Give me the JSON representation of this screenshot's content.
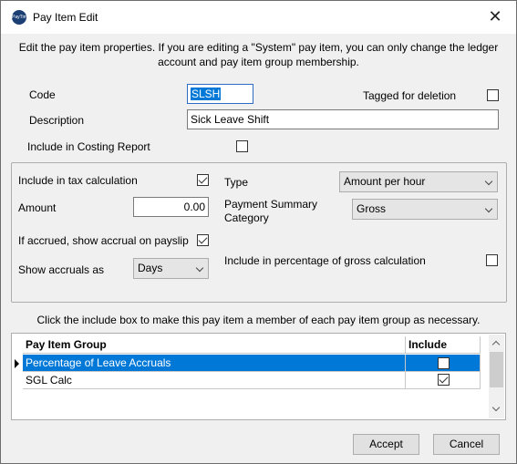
{
  "window": {
    "app_icon_text": "PayTime",
    "title": "Pay Item Edit",
    "close_glyph": "✕"
  },
  "intro_text": "Edit the pay item properties.  If you are editing a \"System\" pay item, you can only change the ledger account and pay item group membership.",
  "code": {
    "label": "Code",
    "value": "SLSH"
  },
  "tagged_for_deletion": {
    "label": "Tagged for deletion",
    "checked": false
  },
  "description": {
    "label": "Description",
    "value": "Sick Leave Shift"
  },
  "include_costing": {
    "label": "Include in Costing Report",
    "checked": false
  },
  "properties": {
    "include_tax": {
      "label": "Include in tax calculation",
      "checked": true
    },
    "amount": {
      "label": "Amount",
      "value": "0.00"
    },
    "show_accrual": {
      "label": "If accrued, show accrual on payslip",
      "checked": true
    },
    "show_accruals_as": {
      "label": "Show accruals as",
      "value": "Days"
    },
    "type": {
      "label": "Type",
      "value": "Amount per hour"
    },
    "payment_summary": {
      "label_line1": "Payment Summary",
      "label_line2": "Category",
      "value": "Gross"
    },
    "include_pct_gross": {
      "label": "Include in percentage of gross calculation",
      "checked": false
    }
  },
  "group_instructions": "Click the include box to make this pay item a member of each pay item group as necessary.",
  "group_grid": {
    "columns": [
      "Pay Item Group",
      "Include"
    ],
    "rows": [
      {
        "name": "Percentage of Leave Accruals",
        "include": false,
        "selected": true
      },
      {
        "name": "SGL Calc",
        "include": true,
        "selected": false
      }
    ]
  },
  "buttons": {
    "accept": "Accept",
    "cancel": "Cancel"
  },
  "colors": {
    "selection": "#0078d7",
    "focus_border": "#2d6bc4"
  }
}
